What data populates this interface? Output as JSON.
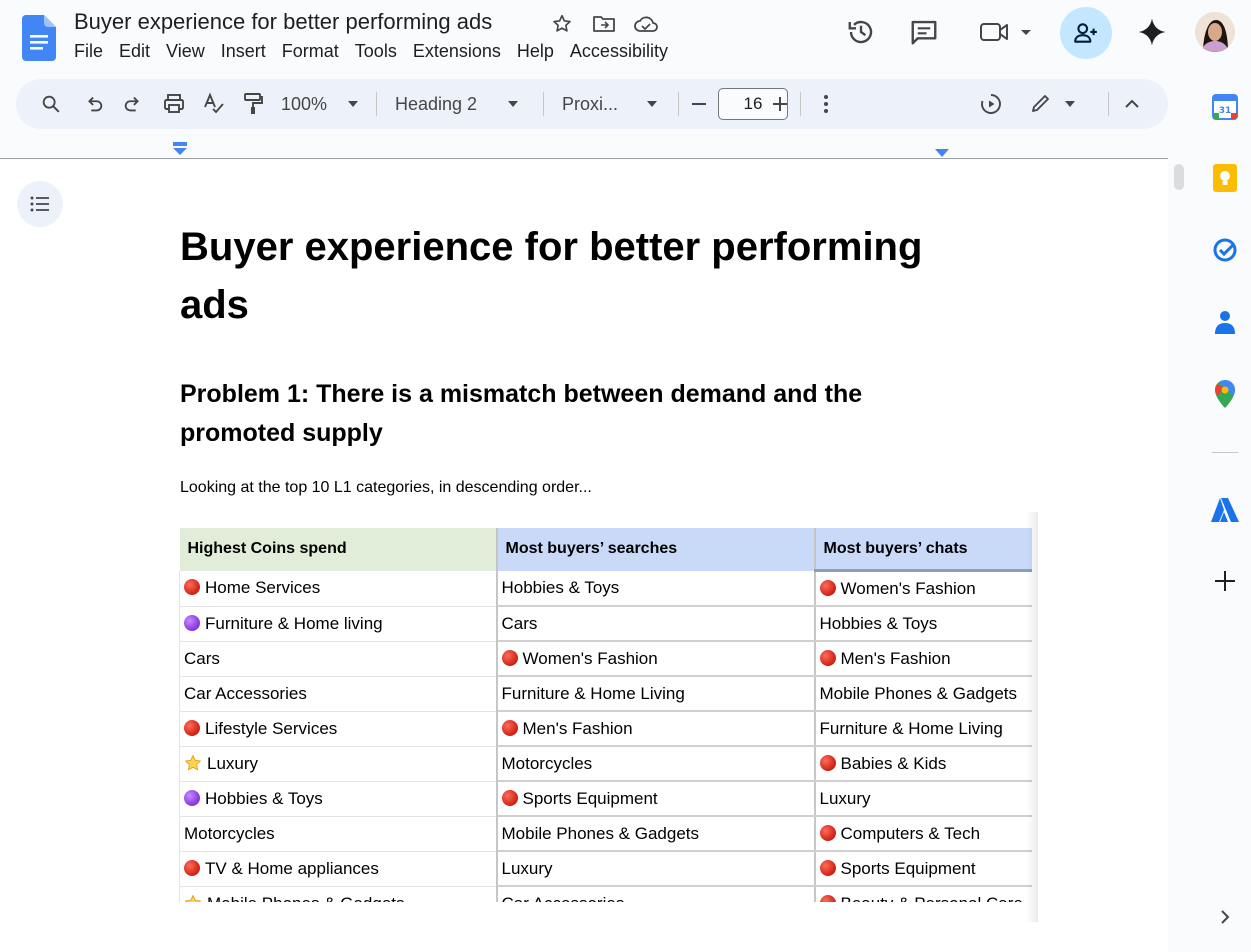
{
  "app": {
    "doc_title": "Buyer experience for better performing ads",
    "menu": [
      "File",
      "Edit",
      "View",
      "Insert",
      "Format",
      "Tools",
      "Extensions",
      "Help",
      "Accessibility"
    ]
  },
  "toolbar": {
    "zoom": "100%",
    "style": "Heading 2",
    "font": "Proxi...",
    "font_size": "16"
  },
  "document": {
    "title": "Buyer experience for better performing ads",
    "heading": "Problem 1: There is a mismatch between demand and the promoted supply",
    "paragraph": "Looking at the top 10 L1 categories, in descending order...",
    "table": {
      "headers": [
        "Highest Coins spend",
        "Most buyers’ searches",
        "Most buyers’ chats"
      ],
      "rows": [
        [
          {
            "text": "Home Services",
            "marker": "red"
          },
          {
            "text": "Hobbies & Toys",
            "marker": ""
          },
          {
            "text": "Women's Fashion",
            "marker": "red"
          }
        ],
        [
          {
            "text": "Furniture & Home living",
            "marker": "purple"
          },
          {
            "text": "Cars",
            "marker": ""
          },
          {
            "text": "Hobbies & Toys",
            "marker": ""
          }
        ],
        [
          {
            "text": "Cars",
            "marker": ""
          },
          {
            "text": "Women's Fashion",
            "marker": "red"
          },
          {
            "text": "Men's Fashion",
            "marker": "red"
          }
        ],
        [
          {
            "text": "Car Accessories",
            "marker": ""
          },
          {
            "text": "Furniture & Home Living",
            "marker": ""
          },
          {
            "text": "Mobile Phones & Gadgets",
            "marker": ""
          }
        ],
        [
          {
            "text": "Lifestyle Services",
            "marker": "red"
          },
          {
            "text": "Men's Fashion",
            "marker": "red"
          },
          {
            "text": "Furniture & Home Living",
            "marker": ""
          }
        ],
        [
          {
            "text": "Luxury",
            "marker": "star"
          },
          {
            "text": "Motorcycles",
            "marker": ""
          },
          {
            "text": "Babies & Kids",
            "marker": "red"
          }
        ],
        [
          {
            "text": "Hobbies & Toys",
            "marker": "purple"
          },
          {
            "text": "Sports Equipment",
            "marker": "red"
          },
          {
            "text": "Luxury",
            "marker": ""
          }
        ],
        [
          {
            "text": "Motorcycles",
            "marker": ""
          },
          {
            "text": "Mobile Phones & Gadgets",
            "marker": ""
          },
          {
            "text": "Computers & Tech",
            "marker": "red"
          }
        ],
        [
          {
            "text": "TV & Home appliances",
            "marker": "red"
          },
          {
            "text": "Luxury",
            "marker": ""
          },
          {
            "text": "Sports Equipment",
            "marker": "red"
          }
        ],
        [
          {
            "text": "Mobile Phones & Gadgets",
            "marker": "star"
          },
          {
            "text": "Car Accessories",
            "marker": ""
          },
          {
            "text": "Beauty & Personal Care",
            "marker": "red"
          }
        ]
      ]
    }
  },
  "colors": {
    "docs_blue": "#4285f4",
    "share_bg": "#c2e7ff",
    "toolbar_bg": "#edf2fa",
    "header_green": "#e1ecd9",
    "header_blue": "#c9daf8"
  },
  "icons": {
    "title": [
      "star-icon",
      "move-to-folder-icon",
      "cloud-saved-icon"
    ],
    "header_right": [
      "version-history-icon",
      "comments-icon",
      "meet-icon",
      "share-icon",
      "gemini-icon"
    ],
    "side_panel": [
      "calendar-icon",
      "keep-icon",
      "tasks-icon",
      "contacts-icon",
      "maps-icon",
      "adobe-icon",
      "add-icon",
      "expand-panel-icon"
    ]
  }
}
